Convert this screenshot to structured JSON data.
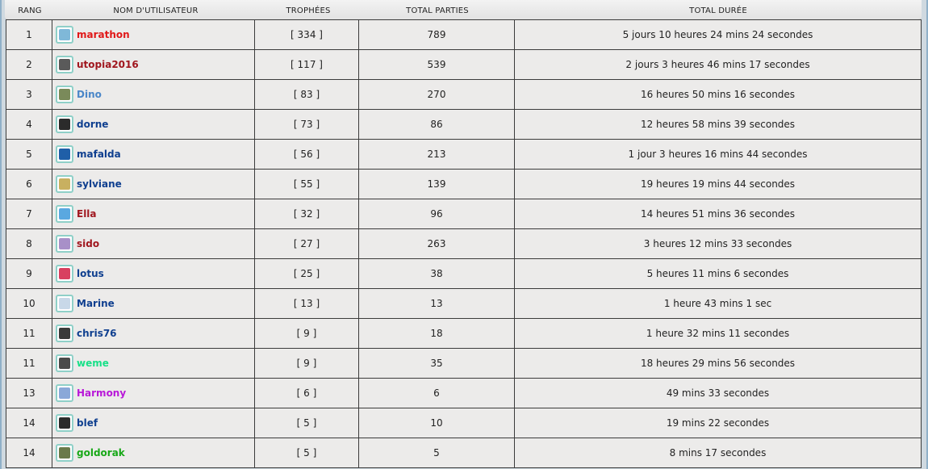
{
  "headers": {
    "rank": "RANG",
    "user": "NOM D'UTILISATEUR",
    "trophies": "TROPHÉES",
    "parts": "TOTAL PARTIES",
    "duration": "TOTAL DURÉE"
  },
  "rows": [
    {
      "rank": "1",
      "name": "marathon",
      "name_color": "#e01818",
      "avatar": "runner-avatar-icon",
      "avatar_color": "#7fb8d8",
      "trophies": "[ 334 ]",
      "parts": "789",
      "duration": "5 jours 10 heures 24 mins 24 secondes"
    },
    {
      "rank": "2",
      "name": "utopia2016",
      "name_color": "#a0161e",
      "avatar": "photo-avatar-icon",
      "avatar_color": "#5a5a5a",
      "trophies": "[ 117 ]",
      "parts": "539",
      "duration": "2 jours 3 heures 46 mins 17 secondes"
    },
    {
      "rank": "3",
      "name": "Dino",
      "name_color": "#4a86c8",
      "avatar": "landscape-avatar-icon",
      "avatar_color": "#7a8a5a",
      "trophies": "[ 83 ]",
      "parts": "270",
      "duration": "16 heures 50 mins 16 secondes"
    },
    {
      "rank": "4",
      "name": "dorne",
      "name_color": "#0f3f8f",
      "avatar": "default-user-avatar-icon",
      "avatar_color": "#2b2b2b",
      "trophies": "[ 73 ]",
      "parts": "86",
      "duration": "12 heures 58 mins 39 secondes"
    },
    {
      "rank": "5",
      "name": "mafalda",
      "name_color": "#0f3f8f",
      "avatar": "yin-yang-avatar-icon",
      "avatar_color": "#1f5fa8",
      "trophies": "[ 56 ]",
      "parts": "213",
      "duration": "1 jour 3 heures 16 mins 44 secondes"
    },
    {
      "rank": "6",
      "name": "sylviane",
      "name_color": "#0f3f8f",
      "avatar": "figure-avatar-icon",
      "avatar_color": "#c8b060",
      "trophies": "[ 55 ]",
      "parts": "139",
      "duration": "19 heures 19 mins 44 secondes"
    },
    {
      "rank": "7",
      "name": "Ella",
      "name_color": "#a0161e",
      "avatar": "cloud-avatar-icon",
      "avatar_color": "#5aa8e0",
      "trophies": "[ 32 ]",
      "parts": "96",
      "duration": "14 heures 51 mins 36 secondes"
    },
    {
      "rank": "8",
      "name": "sido",
      "name_color": "#a0161e",
      "avatar": "portrait-avatar-icon",
      "avatar_color": "#a890c8",
      "trophies": "[ 27 ]",
      "parts": "263",
      "duration": "3 heures 12 mins 33 secondes"
    },
    {
      "rank": "9",
      "name": "lotus",
      "name_color": "#0f3f8f",
      "avatar": "flower-avatar-icon",
      "avatar_color": "#d84060",
      "trophies": "[ 25 ]",
      "parts": "38",
      "duration": "5 heures 11 mins 6 secondes"
    },
    {
      "rank": "10",
      "name": "Marine",
      "name_color": "#0f3f8f",
      "avatar": "pastel-avatar-icon",
      "avatar_color": "#c8d8e8",
      "trophies": "[ 13 ]",
      "parts": "13",
      "duration": "1 heure 43 mins 1 sec"
    },
    {
      "rank": "11",
      "name": "chris76",
      "name_color": "#0f3f8f",
      "avatar": "animal-avatar-icon",
      "avatar_color": "#3a3a3a",
      "trophies": "[ 9 ]",
      "parts": "18",
      "duration": "1 heure 32 mins 11 secondes"
    },
    {
      "rank": "11",
      "name": "weme",
      "name_color": "#18e088",
      "avatar": "dark-photo-avatar-icon",
      "avatar_color": "#4a4a4a",
      "trophies": "[ 9 ]",
      "parts": "35",
      "duration": "18 heures 29 mins 56 secondes"
    },
    {
      "rank": "13",
      "name": "Harmony",
      "name_color": "#b818d8",
      "avatar": "text-logo-avatar-icon",
      "avatar_color": "#8aa8d8",
      "trophies": "[ 6 ]",
      "parts": "6",
      "duration": "49 mins 33 secondes"
    },
    {
      "rank": "14",
      "name": "blef",
      "name_color": "#0f3f8f",
      "avatar": "default-user-avatar-icon",
      "avatar_color": "#2b2b2b",
      "trophies": "[ 5 ]",
      "parts": "10",
      "duration": "19 mins 22 secondes"
    },
    {
      "rank": "14",
      "name": "goldorak",
      "name_color": "#18a818",
      "avatar": "robot-avatar-icon",
      "avatar_color": "#6a7a4a",
      "trophies": "[ 5 ]",
      "parts": "5",
      "duration": "8 mins 17 secondes"
    }
  ]
}
